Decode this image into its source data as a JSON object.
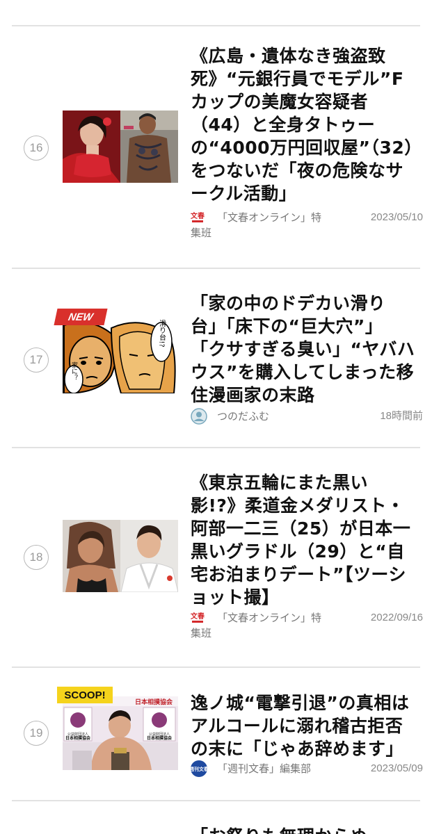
{
  "articles": [
    {
      "rank": "16",
      "title_lines": [
        "《広島・遺体なき強盗致",
        "死》“元銀行員でモデル”F",
        "カップの美魔女容疑者",
        "（44）と全身タトゥー",
        "の“4000万円回収屋”（32）",
        "をつないだ「夜の危険なサ",
        "ークル活動」"
      ],
      "source_lines": [
        "「文春オンライン」特",
        "集班"
      ],
      "source_icon": "bunshun-online-logo",
      "date": "2023/05/10"
    },
    {
      "rank": "17",
      "badge": "NEW",
      "title_lines": [
        "「家の中のドデカい滑り",
        "台」「床下の“巨大穴”」",
        "「クサすぎる臭い」“ヤバハ",
        "ウス”を購入してしまった移",
        "住漫画家の末路"
      ],
      "source_lines": [
        "つのだふむ"
      ],
      "source_icon": "user-avatar-icon",
      "date": "18時間前",
      "manga_text": [
        "滑り台!?",
        "家に？"
      ]
    },
    {
      "rank": "18",
      "title_lines": [
        "《東京五輪にまた黒い",
        "影!?》柔道金メダリスト・",
        "阿部一二三（25）が日本一",
        "黒いグラドル（29）と“自",
        "宅お泊まりデート”【ツーシ",
        "ョット撮】"
      ],
      "source_lines": [
        "「文春オンライン」特",
        "集班"
      ],
      "source_icon": "bunshun-online-logo",
      "date": "2022/09/16"
    },
    {
      "rank": "19",
      "badge": "SCOOP!",
      "title_lines": [
        "逸ノ城“電撃引退”の真相は",
        "アルコールに溺れ稽古拒否",
        "の末に「じゃあ辞めます」"
      ],
      "source_lines": [
        "「週刊文春」編集部"
      ],
      "source_icon": "shukan-bunshun-logo",
      "date": "2023/05/09",
      "sign_text": [
        "日本相撲協会",
        "公益財団法人",
        "日本相撲協会"
      ]
    },
    {
      "title_lines": [
        "「お祭りも無理からぬ"
      ]
    }
  ],
  "colors": {
    "separator": "#e2e2e2",
    "badge_red": "#d9302c",
    "badge_yellow": "#f5d31c"
  }
}
